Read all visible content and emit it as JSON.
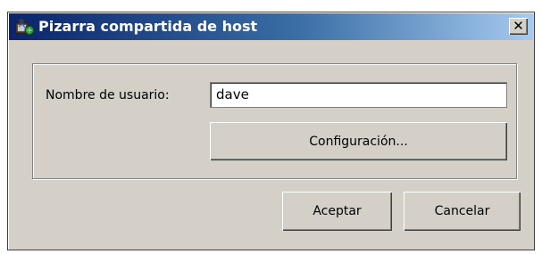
{
  "window": {
    "title": "Pizarra compartida de host",
    "close_glyph": "✕",
    "icon": "whiteboard-app-icon"
  },
  "form": {
    "username_label": "Nombre de usuario:",
    "username_value": "dave",
    "config_button": "Configuración..."
  },
  "footer": {
    "ok_button": "Aceptar",
    "cancel_button": "Cancelar"
  },
  "colors": {
    "titlebar_start": "#0a246a",
    "titlebar_end": "#a6caf0",
    "face": "#d4d0c8"
  }
}
